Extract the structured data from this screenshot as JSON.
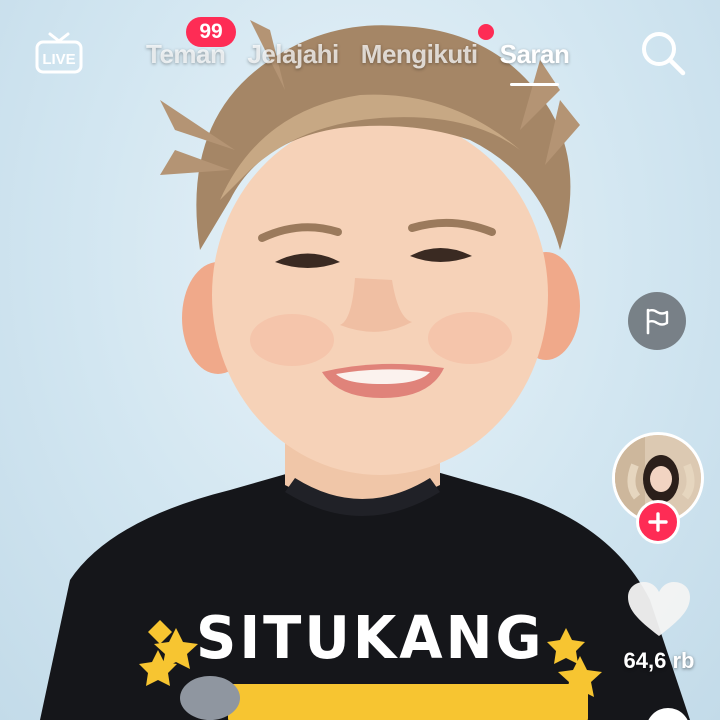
{
  "nav": {
    "live_label": "LIVE",
    "tabs": [
      {
        "label": "Teman",
        "active": false
      },
      {
        "label": "Jelajahi",
        "active": false
      },
      {
        "label": "Mengikuti",
        "active": false
      },
      {
        "label": "Saran",
        "active": true
      }
    ],
    "friends_badge": "99",
    "following_has_dot": true,
    "search_icon": "search-icon"
  },
  "video": {
    "shirt_text": "SITUKANG"
  },
  "actions": {
    "report_icon": "flag-icon",
    "follow_icon": "plus-icon",
    "like_icon": "heart-icon",
    "like_count": "64,6 rb"
  },
  "colors": {
    "accent": "#fe2c55",
    "text": "#ffffff"
  }
}
